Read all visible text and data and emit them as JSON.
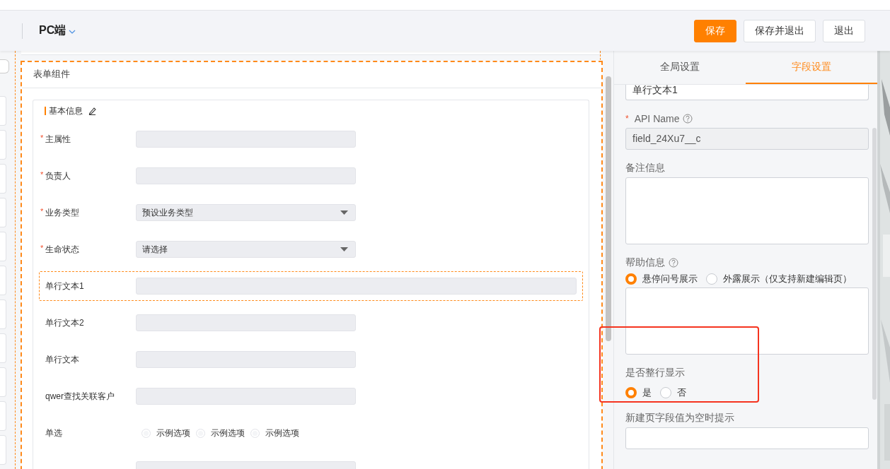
{
  "header": {
    "platform": "PC端",
    "buttons": [
      {
        "label": "保存",
        "kind": "primary"
      },
      {
        "label": "保存并退出",
        "kind": "default"
      },
      {
        "label": "退出",
        "kind": "default"
      }
    ]
  },
  "palette": [
    {
      "kind": "search"
    },
    {
      "kind": "card"
    },
    {
      "kind": "card"
    },
    {
      "kind": "card"
    },
    {
      "kind": "card"
    },
    {
      "kind": "card"
    },
    {
      "kind": "card"
    },
    {
      "kind": "card"
    },
    {
      "kind": "card"
    },
    {
      "kind": "card"
    },
    {
      "kind": "card"
    },
    {
      "kind": "card"
    }
  ],
  "canvas": {
    "panel_title": "表单组件",
    "section_title": "基本信息",
    "fields": [
      {
        "label": "主属性",
        "required_mark": "*",
        "kind": "text",
        "selected": false
      },
      {
        "label": "负责人",
        "required_mark": "*",
        "kind": "text",
        "selected": false
      },
      {
        "label": "业务类型",
        "required_mark": "*",
        "kind": "select",
        "value": "预设业务类型",
        "selected": false
      },
      {
        "label": "生命状态",
        "required_mark": "*",
        "kind": "select",
        "value": "请选择",
        "selected": false
      },
      {
        "label": "单行文本1",
        "kind": "text",
        "selected": true
      },
      {
        "label": "单行文本2",
        "kind": "text",
        "selected": false
      },
      {
        "label": "单行文本",
        "kind": "text",
        "selected": false
      },
      {
        "label": "qwer查找关联客户",
        "kind": "text",
        "selected": false
      },
      {
        "label": "单选",
        "kind": "radio",
        "selected": false,
        "options": [
          {
            "label": "示例选项",
            "selected": false
          },
          {
            "label": "示例选项",
            "selected": false
          },
          {
            "label": "示例选项",
            "selected": false
          }
        ]
      },
      {
        "kind": "text",
        "selected": false
      }
    ]
  },
  "settings": {
    "tabs": [
      {
        "label": "全局设置",
        "selected": false
      },
      {
        "label": "字段设置",
        "selected": true
      }
    ],
    "fields": [
      {
        "kind": "input",
        "value": "单行文本1",
        "disabled": false
      },
      {
        "kind": "input",
        "label": "API Name",
        "required_mark": "*",
        "help": true,
        "value": "field_24Xu7__c",
        "disabled": true
      },
      {
        "kind": "textarea",
        "label": "备注信息"
      },
      {
        "kind": "radios-textarea",
        "label": "帮助信息",
        "help": true,
        "options": [
          {
            "label": "悬停问号展示",
            "selected": true
          },
          {
            "label": "外露展示（仅支持新建编辑页）",
            "selected": false
          }
        ]
      },
      {
        "kind": "radios",
        "label": "是否整行显示",
        "annotated": true,
        "options": [
          {
            "label": "是",
            "selected": true
          },
          {
            "label": "否",
            "selected": false
          }
        ]
      },
      {
        "kind": "input",
        "label": "新建页字段值为空时提示",
        "disabled": false
      }
    ]
  }
}
